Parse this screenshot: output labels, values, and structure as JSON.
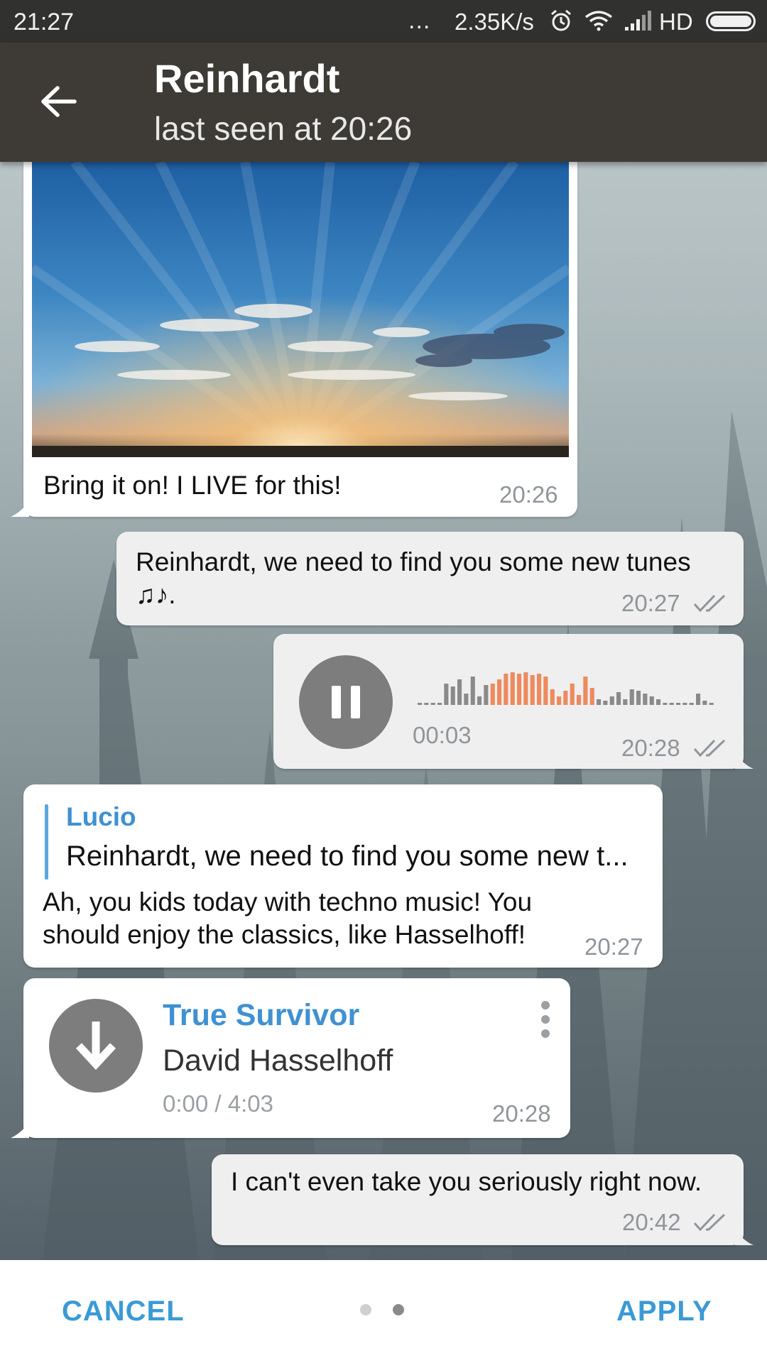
{
  "status_bar": {
    "time": "21:27",
    "more": "...",
    "speed": "2.35K/s",
    "network": "HD"
  },
  "header": {
    "contact_name": "Reinhardt",
    "last_seen": "last seen at 20:26"
  },
  "messages": [
    {
      "type": "photo",
      "direction": "incoming",
      "caption": "Bring it on! I LIVE for this!",
      "time": "20:26"
    },
    {
      "type": "text",
      "direction": "outgoing",
      "text_line1": "Reinhardt, we need to find you some new tunes",
      "text_line2": "♫♪.",
      "time": "20:27",
      "read": true
    },
    {
      "type": "voice",
      "direction": "outgoing",
      "duration": "00:03",
      "time": "20:28",
      "read": true,
      "progress": 0.35
    },
    {
      "type": "reply",
      "direction": "incoming",
      "quote_author": "Lucio",
      "quote_text": "Reinhardt, we need to find you some new t...",
      "text_line1": "Ah, you kids today with techno music! You",
      "text_line2": "should enjoy the classics, like Hasselhoff!",
      "time": "20:27"
    },
    {
      "type": "audio",
      "direction": "incoming",
      "title": "True Survivor",
      "artist": "David Hasselhoff",
      "progress_text": "0:00 / 4:03",
      "time": "20:28"
    },
    {
      "type": "text",
      "direction": "outgoing",
      "text": "I can't even take you seriously right now.",
      "time": "20:42",
      "read": true
    }
  ],
  "bottom_bar": {
    "cancel_label": "CANCEL",
    "apply_label": "APPLY",
    "page_count": 2,
    "current_page": 2
  },
  "colors": {
    "accent": "#3b9ad6",
    "header_bg": "#3e3b36",
    "waveform_played": "#ee8a5e",
    "waveform_unplayed": "#8a8a8a"
  }
}
